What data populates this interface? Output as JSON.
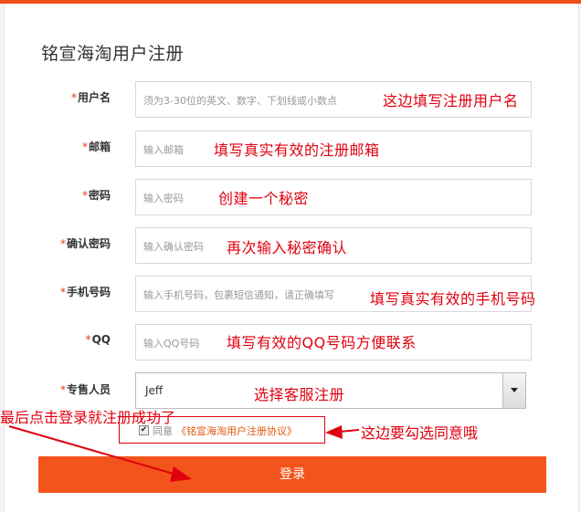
{
  "page": {
    "title": "铭宣海淘用户注册"
  },
  "form": {
    "required_mark": "*",
    "fields": [
      {
        "label": "用户名",
        "placeholder": "须为3-30位的英文、数字、下划线或小数点",
        "annotation": "这边填写注册用户名"
      },
      {
        "label": "邮箱",
        "placeholder": "输入邮箱",
        "annotation": "填写真实有效的注册邮箱"
      },
      {
        "label": "密码",
        "placeholder": "输入密码",
        "annotation": "创建一个秘密"
      },
      {
        "label": "确认密码",
        "placeholder": "输入确认密码",
        "annotation": "再次输入秘密确认"
      },
      {
        "label": "手机号码",
        "placeholder": "输入手机号码，包裹短信通知，请正确填写",
        "annotation": "填写真实有效的手机号码"
      },
      {
        "label": "QQ",
        "placeholder": "输入QQ号码",
        "annotation": "填写有效的QQ号码方便联系"
      }
    ],
    "salesperson": {
      "label": "专售人员",
      "selected": "Jeff",
      "annotation": "选择客服注册"
    },
    "agreement": {
      "prefix": "同意",
      "link": "《铭宣海淘用户注册协议》",
      "checked_glyph": "✔"
    },
    "submit_label": "登录"
  },
  "annotations": {
    "agree_note": "这边要勾选同意哦",
    "login_note": "最后点击登录就注册成功了"
  },
  "colors": {
    "accent": "#f3541b",
    "annotation": "#e0000f",
    "link": "#e0580d"
  }
}
